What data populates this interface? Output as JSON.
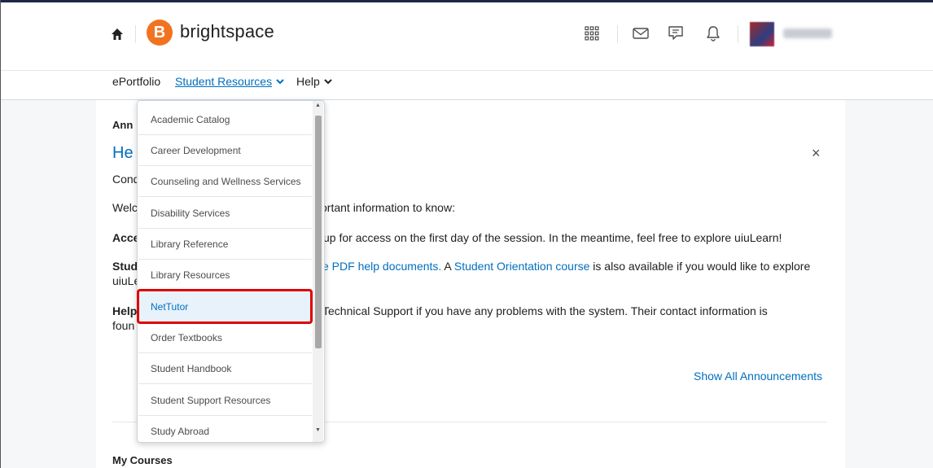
{
  "header": {
    "brand": "brightspace",
    "logo_letter": "B",
    "icons": [
      "home-icon",
      "course-selector-icon",
      "mail-icon",
      "chat-icon",
      "bell-icon"
    ]
  },
  "nav": {
    "items": [
      {
        "label": "ePortfolio"
      },
      {
        "label": "Student Resources"
      },
      {
        "label": "Help"
      }
    ]
  },
  "announcements": {
    "header": "Ann",
    "title": "He",
    "close": "×",
    "lines": [
      {
        "prefix": "Cond",
        "text": ""
      },
      {
        "prefix": "Welc",
        "text": "ortant information to know:"
      },
      {
        "prefix": "Acce",
        "text": "up for access on the first day of the session. In the meantime, feel free to explore uiuLearn!"
      },
      {
        "prefix": "Stud",
        "link1": "e PDF help documents.",
        "mid": " A ",
        "link2": "Student Orientation course",
        "rest": " is also available if you would like to explore"
      },
      {
        "prefix": "uiuLe",
        "text": ""
      },
      {
        "prefix": "Help",
        "text": "Technical Support if you have any problems with the system. Their contact information is"
      },
      {
        "prefix": "foun",
        "text": ""
      }
    ],
    "show_all": "Show All Announcements"
  },
  "my_courses": "My Courses",
  "dropdown": {
    "items": [
      "Academic Catalog",
      "Career Development",
      "Counseling and Wellness Services",
      "Disability Services",
      "Library Reference",
      "Library Resources",
      "NetTutor",
      "Order Textbooks",
      "Student Handbook",
      "Student Support Resources",
      "Study Abroad"
    ],
    "highlighted": "NetTutor"
  },
  "colors": {
    "accent": "#006fbf",
    "brand": "#f1731f",
    "highlight": "#e00000"
  }
}
